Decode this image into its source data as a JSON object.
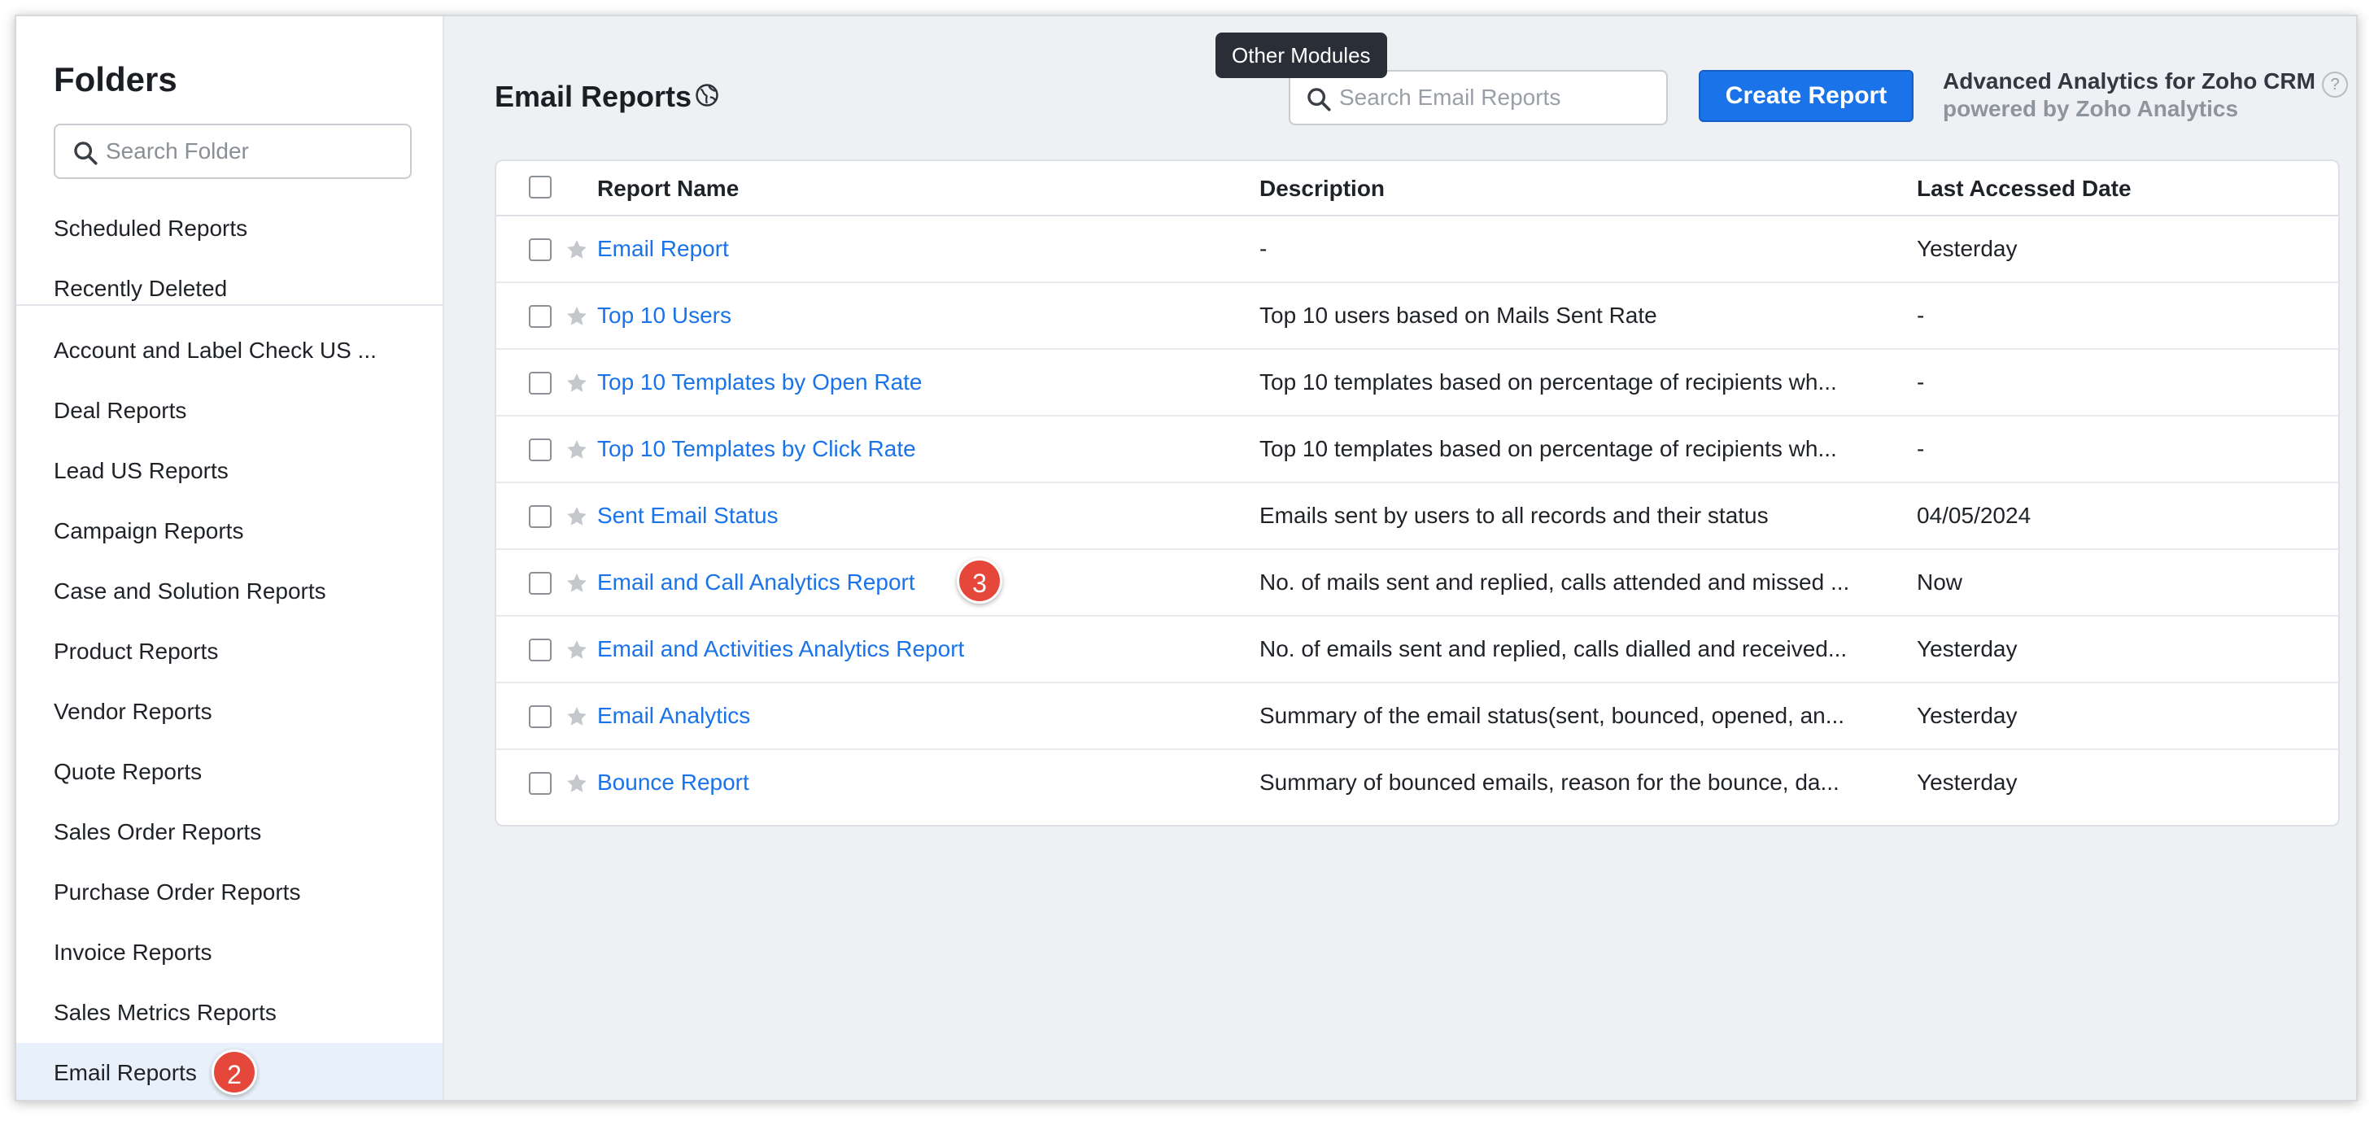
{
  "sidebar": {
    "title": "Folders",
    "search_placeholder": "Search Folder",
    "items": [
      {
        "label": "Scheduled Reports"
      },
      {
        "label": "Recently Deleted"
      },
      {
        "label": "Account and Label Check US ..."
      },
      {
        "label": "Deal Reports"
      },
      {
        "label": "Lead US Reports"
      },
      {
        "label": "Campaign Reports"
      },
      {
        "label": "Case and Solution Reports"
      },
      {
        "label": "Product Reports"
      },
      {
        "label": "Vendor Reports"
      },
      {
        "label": "Quote Reports"
      },
      {
        "label": "Sales Order Reports"
      },
      {
        "label": "Purchase Order Reports"
      },
      {
        "label": "Invoice Reports"
      },
      {
        "label": "Sales Metrics Reports"
      },
      {
        "label": "Email Reports"
      }
    ],
    "active_item": "Email Reports",
    "active_badge": "2"
  },
  "header": {
    "title": "Email Reports",
    "search_placeholder": "Search Email Reports",
    "tooltip": "Other Modules",
    "create_button": "Create Report",
    "analytics_title": "Advanced Analytics for Zoho CRM",
    "analytics_subtitle": "powered by Zoho Analytics",
    "help_glyph": "?"
  },
  "table": {
    "columns": {
      "name": "Report Name",
      "description": "Description",
      "date": "Last Accessed Date"
    },
    "rows": [
      {
        "name": "Email Report",
        "description": "-",
        "date": "Yesterday"
      },
      {
        "name": "Top 10 Users",
        "description": "Top 10 users based on Mails Sent Rate",
        "date": "-"
      },
      {
        "name": "Top 10 Templates by Open Rate",
        "description": "Top 10 templates based on percentage of recipients wh...",
        "date": "-"
      },
      {
        "name": "Top 10 Templates by Click Rate",
        "description": "Top 10 templates based on percentage of recipients wh...",
        "date": "-"
      },
      {
        "name": "Sent Email Status",
        "description": "Emails sent by users to all records and their status",
        "date": "04/05/2024"
      },
      {
        "name": "Email and Call Analytics Report",
        "description": "No. of mails sent and replied, calls attended and missed ...",
        "date": "Now"
      },
      {
        "name": "Email and Activities Analytics Report",
        "description": "No. of emails sent and replied, calls dialled and received...",
        "date": "Yesterday"
      },
      {
        "name": "Email Analytics",
        "description": "Summary of the email status(sent, bounced, opened, an...",
        "date": "Yesterday"
      },
      {
        "name": "Bounce Report",
        "description": "Summary of bounced emails, reason for the bounce, da...",
        "date": "Yesterday"
      }
    ],
    "row_badge": "3"
  },
  "colors": {
    "accent": "#1a73e8",
    "badge": "#e5483b",
    "active_folder_bg": "#e8f1fb"
  }
}
